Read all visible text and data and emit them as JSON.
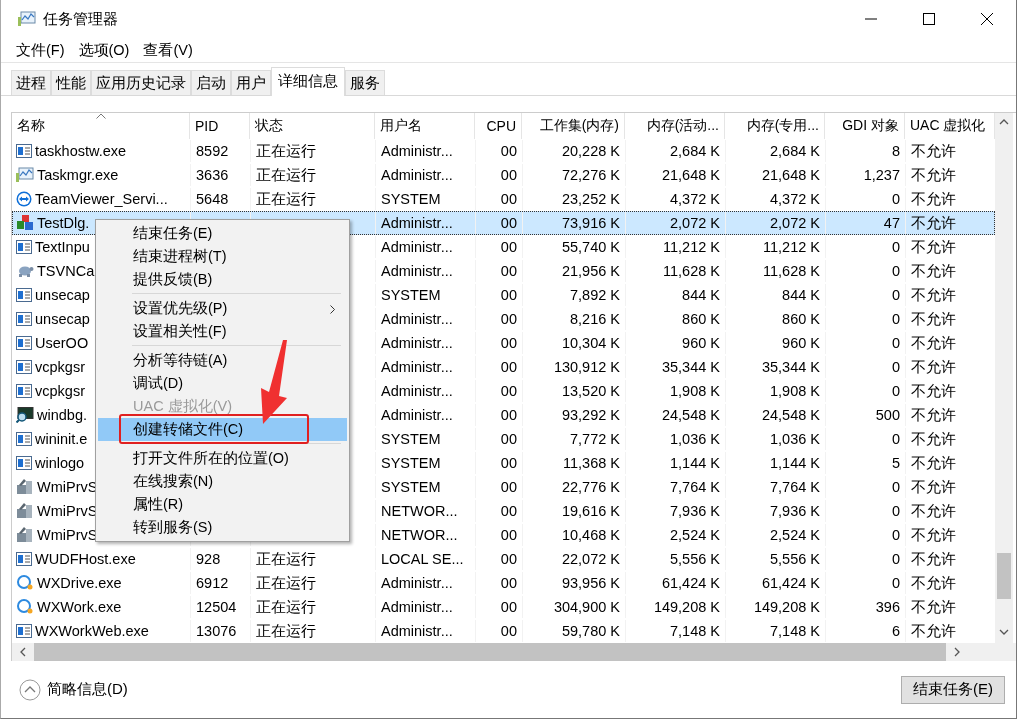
{
  "window": {
    "title": "任务管理器"
  },
  "menu_bar": [
    "文件(F)",
    "选项(O)",
    "查看(V)"
  ],
  "tabs": [
    {
      "label": "进程",
      "selected": false
    },
    {
      "label": "性能",
      "selected": false
    },
    {
      "label": "应用历史记录",
      "selected": false
    },
    {
      "label": "启动",
      "selected": false
    },
    {
      "label": "用户",
      "selected": false
    },
    {
      "label": "详细信息",
      "selected": true
    },
    {
      "label": "服务",
      "selected": false
    }
  ],
  "table": {
    "columns": [
      {
        "label": "名称",
        "sorted": true
      },
      {
        "label": "PID",
        "sorted": false
      },
      {
        "label": "状态",
        "sorted": false
      },
      {
        "label": "用户名",
        "sorted": false
      },
      {
        "label": "CPU",
        "sorted": false
      },
      {
        "label": "工作集(内存)",
        "sorted": false
      },
      {
        "label": "内存(活动...",
        "sorted": false
      },
      {
        "label": "内存(专用...",
        "sorted": false
      },
      {
        "label": "GDI 对象",
        "sorted": false
      },
      {
        "label": "UAC 虚拟化",
        "sorted": false
      }
    ],
    "rows": [
      {
        "kind": "window",
        "selected": false,
        "cells": [
          "taskhostw.exe",
          "8592",
          "正在运行",
          "Administr...",
          "00",
          "20,228 K",
          "2,684 K",
          "2,684 K",
          "8",
          "不允许"
        ]
      },
      {
        "kind": "chart",
        "selected": false,
        "cells": [
          "Taskmgr.exe",
          "3636",
          "正在运行",
          "Administr...",
          "00",
          "72,276 K",
          "21,648 K",
          "21,648 K",
          "1,237",
          "不允许"
        ]
      },
      {
        "kind": "remote",
        "selected": false,
        "cells": [
          "TeamViewer_Servi...",
          "5648",
          "正在运行",
          "SYSTEM",
          "00",
          "23,252 K",
          "4,372 K",
          "4,372 K",
          "0",
          "不允许"
        ]
      },
      {
        "kind": "blocks",
        "selected": true,
        "cells": [
          "TestDlg.",
          "",
          "",
          "Administr...",
          "00",
          "73,916 K",
          "2,072 K",
          "2,072 K",
          "47",
          "不允许"
        ]
      },
      {
        "kind": "window",
        "selected": false,
        "cells": [
          "TextInpu",
          "",
          "",
          "Administr...",
          "00",
          "55,740 K",
          "11,212 K",
          "11,212 K",
          "0",
          "不允许"
        ]
      },
      {
        "kind": "turtle",
        "selected": false,
        "cells": [
          "TSVNCa",
          "",
          "",
          "Administr...",
          "00",
          "21,956 K",
          "11,628 K",
          "11,628 K",
          "0",
          "不允许"
        ]
      },
      {
        "kind": "window",
        "selected": false,
        "cells": [
          "unsecap",
          "",
          "",
          "SYSTEM",
          "00",
          "7,892 K",
          "844 K",
          "844 K",
          "0",
          "不允许"
        ]
      },
      {
        "kind": "window",
        "selected": false,
        "cells": [
          "unsecap",
          "",
          "",
          "Administr...",
          "00",
          "8,216 K",
          "860 K",
          "860 K",
          "0",
          "不允许"
        ]
      },
      {
        "kind": "window",
        "selected": false,
        "cells": [
          "UserOO",
          "",
          "",
          "Administr...",
          "00",
          "10,304 K",
          "960 K",
          "960 K",
          "0",
          "不允许"
        ]
      },
      {
        "kind": "window",
        "selected": false,
        "cells": [
          "vcpkgsr",
          "",
          "",
          "Administr...",
          "00",
          "130,912 K",
          "35,344 K",
          "35,344 K",
          "0",
          "不允许"
        ]
      },
      {
        "kind": "window",
        "selected": false,
        "cells": [
          "vcpkgsr",
          "",
          "",
          "Administr...",
          "00",
          "13,520 K",
          "1,908 K",
          "1,908 K",
          "0",
          "不允许"
        ]
      },
      {
        "kind": "debugger",
        "selected": false,
        "cells": [
          "windbg.",
          "",
          "",
          "Administr...",
          "00",
          "93,292 K",
          "24,548 K",
          "24,548 K",
          "500",
          "不允许"
        ]
      },
      {
        "kind": "window",
        "selected": false,
        "cells": [
          "wininit.e",
          "",
          "",
          "SYSTEM",
          "00",
          "7,772 K",
          "1,036 K",
          "1,036 K",
          "0",
          "不允许"
        ]
      },
      {
        "kind": "window",
        "selected": false,
        "cells": [
          "winlogo",
          "",
          "",
          "SYSTEM",
          "00",
          "11,368 K",
          "1,144 K",
          "1,144 K",
          "5",
          "不允许"
        ]
      },
      {
        "kind": "tools",
        "selected": false,
        "cells": [
          "WmiPrvS",
          "",
          "",
          "SYSTEM",
          "00",
          "22,776 K",
          "7,764 K",
          "7,764 K",
          "0",
          "不允许"
        ]
      },
      {
        "kind": "tools",
        "selected": false,
        "cells": [
          "WmiPrvS",
          "",
          "",
          "NETWOR...",
          "00",
          "19,616 K",
          "7,936 K",
          "7,936 K",
          "0",
          "不允许"
        ]
      },
      {
        "kind": "tools",
        "selected": false,
        "cells": [
          "WmiPrvS",
          "",
          "",
          "NETWOR...",
          "00",
          "10,468 K",
          "2,524 K",
          "2,524 K",
          "0",
          "不允许"
        ]
      },
      {
        "kind": "window",
        "selected": false,
        "cells": [
          "WUDFHost.exe",
          "928",
          "正在运行",
          "LOCAL SE...",
          "00",
          "22,072 K",
          "5,556 K",
          "5,556 K",
          "0",
          "不允许"
        ]
      },
      {
        "kind": "chat",
        "selected": false,
        "cells": [
          "WXDrive.exe",
          "6912",
          "正在运行",
          "Administr...",
          "00",
          "93,956 K",
          "61,424 K",
          "61,424 K",
          "0",
          "不允许"
        ]
      },
      {
        "kind": "chat",
        "selected": false,
        "cells": [
          "WXWork.exe",
          "12504",
          "正在运行",
          "Administr...",
          "00",
          "304,900 K",
          "149,208 K",
          "149,208 K",
          "396",
          "不允许"
        ]
      },
      {
        "kind": "window",
        "selected": false,
        "cells": [
          "WXWorkWeb.exe",
          "13076",
          "正在运行",
          "Administr...",
          "00",
          "59,780 K",
          "7,148 K",
          "7,148 K",
          "6",
          "不允许"
        ]
      }
    ]
  },
  "context_menu": {
    "items": [
      {
        "kind": "item",
        "label": "结束任务(E)",
        "disabled": false,
        "selected": false,
        "submenu": false,
        "outlined": false
      },
      {
        "kind": "item",
        "label": "结束进程树(T)",
        "disabled": false,
        "selected": false,
        "submenu": false,
        "outlined": false
      },
      {
        "kind": "item",
        "label": "提供反馈(B)",
        "disabled": false,
        "selected": false,
        "submenu": false,
        "outlined": false
      },
      {
        "kind": "separator"
      },
      {
        "kind": "item",
        "label": "设置优先级(P)",
        "disabled": false,
        "selected": false,
        "submenu": true,
        "outlined": false
      },
      {
        "kind": "item",
        "label": "设置相关性(F)",
        "disabled": false,
        "selected": false,
        "submenu": false,
        "outlined": false
      },
      {
        "kind": "separator"
      },
      {
        "kind": "item",
        "label": "分析等待链(A)",
        "disabled": false,
        "selected": false,
        "submenu": false,
        "outlined": false
      },
      {
        "kind": "item",
        "label": "调试(D)",
        "disabled": false,
        "selected": false,
        "submenu": false,
        "outlined": false
      },
      {
        "kind": "item",
        "label": "UAC 虚拟化(V)",
        "disabled": true,
        "selected": false,
        "submenu": false,
        "outlined": false
      },
      {
        "kind": "item",
        "label": "创建转储文件(C)",
        "disabled": false,
        "selected": true,
        "submenu": false,
        "outlined": true
      },
      {
        "kind": "separator"
      },
      {
        "kind": "item",
        "label": "打开文件所在的位置(O)",
        "disabled": false,
        "selected": false,
        "submenu": false,
        "outlined": false
      },
      {
        "kind": "item",
        "label": "在线搜索(N)",
        "disabled": false,
        "selected": false,
        "submenu": false,
        "outlined": false
      },
      {
        "kind": "item",
        "label": "属性(R)",
        "disabled": false,
        "selected": false,
        "submenu": false,
        "outlined": false
      },
      {
        "kind": "item",
        "label": "转到服务(S)",
        "disabled": false,
        "selected": false,
        "submenu": false,
        "outlined": false
      }
    ]
  },
  "annotation_arrow": true,
  "footer": {
    "details_toggle": "简略信息(D)",
    "end_task_button": "结束任务(E)"
  }
}
